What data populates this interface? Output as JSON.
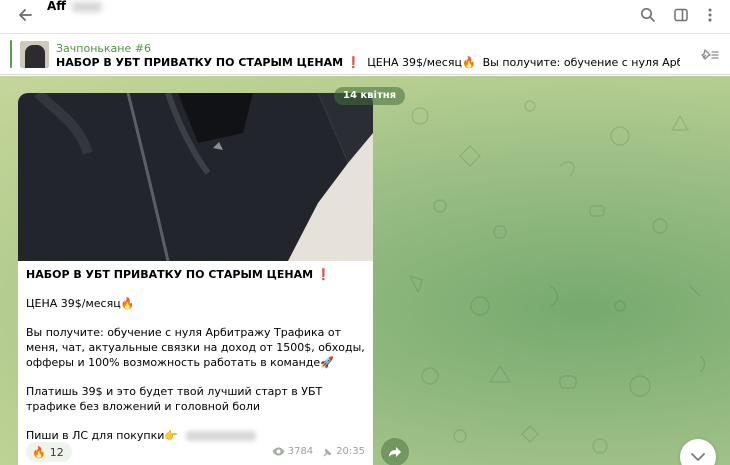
{
  "header": {
    "title": "Aff"
  },
  "pinned": {
    "author": "Зачпонькане #6",
    "title": "НАБОР В УБТ ПРИВАТКУ ПО СТАРЫМ ЦЕНАМ",
    "price": "ЦЕНА 39$/месяц",
    "preview": "Вы получите: обучение с нуля Арбитражу Трафи..."
  },
  "chat": {
    "date": "14 квітня",
    "message": {
      "title": "НАБОР В УБТ ПРИВАТКУ ПО СТАРЫМ ЦЕНАМ",
      "price": "ЦЕНА 39$/месяц",
      "benefits": "Вы получите: обучение с нуля Арбитражу Трафика от меня, чат, актуальные связки на доход от 1500$, обходы, офферы и 100% возможность работать в команде",
      "pay": "Платишь 39$ и это будет твой лучший старт в УБТ трафике без вложений и головной боли",
      "contact": "Пиши в ЛС для покупки",
      "reaction_count": "12",
      "views": "3784",
      "time": "20:35"
    }
  },
  "icons": {
    "back": "arrow-left-icon",
    "search": "search-icon",
    "sidebar": "sidebar-toggle-icon",
    "more": "more-vertical-icon",
    "pinned_list": "pinned-list-icon",
    "reaction": "fire-emoji",
    "views": "eye-icon",
    "pinned": "pin-icon",
    "forward": "forward-arrow-icon",
    "scroll": "chevron-down-icon"
  },
  "colors": {
    "accent": "#4f9443",
    "chat_bg": "#9cbf86"
  }
}
